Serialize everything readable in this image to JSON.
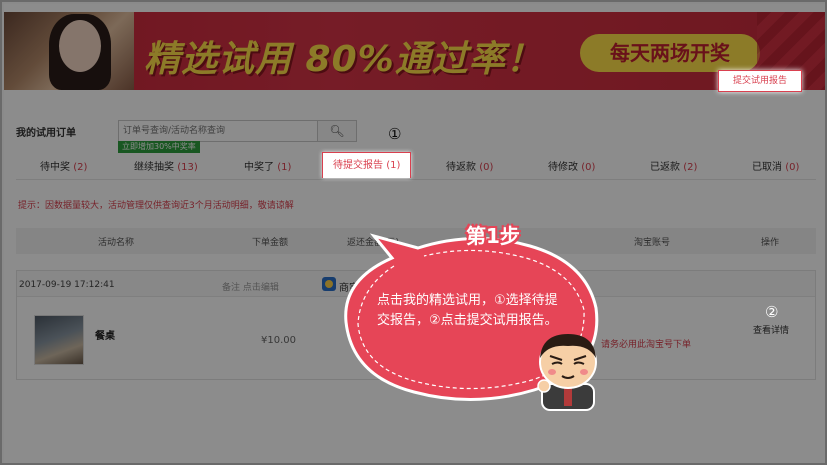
{
  "banner": {
    "title": "精选试用 80%通过率！",
    "pill": "每天两场开奖"
  },
  "search": {
    "label": "我的试用订单",
    "placeholder": "订单号查询/活动名称查询",
    "promo": "立即增加30%中奖率"
  },
  "markers": {
    "one": "①",
    "two": "②"
  },
  "tabs": [
    {
      "label": "待中奖",
      "count": "(2)"
    },
    {
      "label": "继续抽奖",
      "count": "(13)"
    },
    {
      "label": "中奖了",
      "count": "(1)"
    },
    {
      "label": "待提交报告",
      "count": "(1)"
    },
    {
      "label": "待返款",
      "count": "(0)"
    },
    {
      "label": "待修改",
      "count": "(0)"
    },
    {
      "label": "已返款",
      "count": "(2)"
    },
    {
      "label": "已取消",
      "count": "(0)"
    }
  ],
  "tip": "提示：因数据量较大，活动管理仅供查询近3个月活动明细，敬请谅解",
  "table_headers": [
    "活动名称",
    "下单金额",
    "返还金额(元)",
    "淘宝账号",
    "操作"
  ],
  "order": {
    "time": "2017-09-19 17:12:41",
    "remark": "备注 点击编辑",
    "shop": "商家",
    "product_name": "餐桌",
    "price": "¥10.00",
    "note": "请务必用此淘宝号下单",
    "detail_link": "查看详情",
    "submit_button": "提交试用报告"
  },
  "callout": {
    "step": "第1步",
    "text": "点击我的精选试用，①选择待提交报告，②点击提交试用报告。"
  },
  "colors": {
    "accent": "#d9404f",
    "callout": "#e64557",
    "banner": "#d73447",
    "promo": "#2e9e3e"
  }
}
